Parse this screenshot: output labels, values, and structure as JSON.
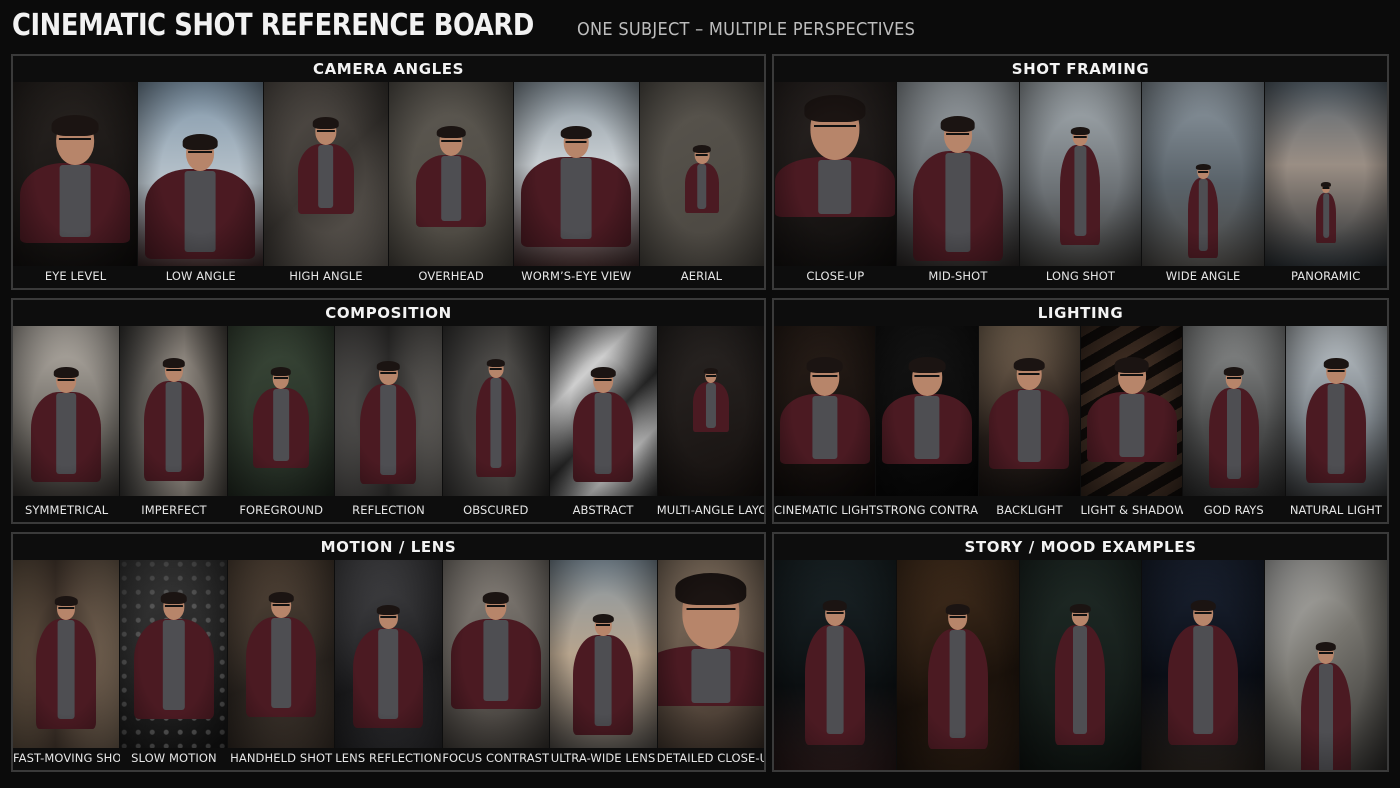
{
  "header": {
    "title": "CINEMATIC SHOT REFERENCE BOARD",
    "subtitle": "ONE SUBJECT – MULTIPLE PERSPECTIVES"
  },
  "panels": {
    "camera_angles": {
      "title": "CAMERA ANGLES",
      "items": [
        "EYE LEVEL",
        "LOW ANGLE",
        "HIGH ANGLE",
        "OVERHEAD",
        "WORM’S-EYE VIEW",
        "AERIAL"
      ]
    },
    "shot_framing": {
      "title": "SHOT FRAMING",
      "items": [
        "CLOSE-UP",
        "MID-SHOT",
        "LONG SHOT",
        "WIDE ANGLE",
        "PANORAMIC"
      ]
    },
    "composition": {
      "title": "COMPOSITION",
      "items": [
        "SYMMETRICAL",
        "IMPERFECT",
        "FOREGROUND",
        "REFLECTION",
        "OBSCURED",
        "ABSTRACT",
        "MULTI-ANGLE LAYOUT"
      ]
    },
    "lighting": {
      "title": "LIGHTING",
      "items": [
        "CINEMATIC LIGHTING",
        "STRONG CONTRAST",
        "BACKLIGHT",
        "LIGHT & SHADOW",
        "GOD RAYS",
        "NATURAL LIGHT"
      ]
    },
    "motion_lens": {
      "title": "MOTION / LENS",
      "items": [
        "FAST-MOVING SHOT",
        "SLOW MOTION",
        "HANDHELD SHOT",
        "LENS REFLECTION",
        "FOCUS CONTRAST",
        "ULTRA-WIDE LENS",
        "DETAILED CLOSE-UP"
      ]
    },
    "story_mood": {
      "title": "STORY / MOOD EXAMPLES",
      "items": []
    }
  },
  "colors": {
    "background": "#0b0b0b",
    "panel_border": "#3a3a3a",
    "jacket": "#4b1a22",
    "text": "#f3f3f3"
  }
}
